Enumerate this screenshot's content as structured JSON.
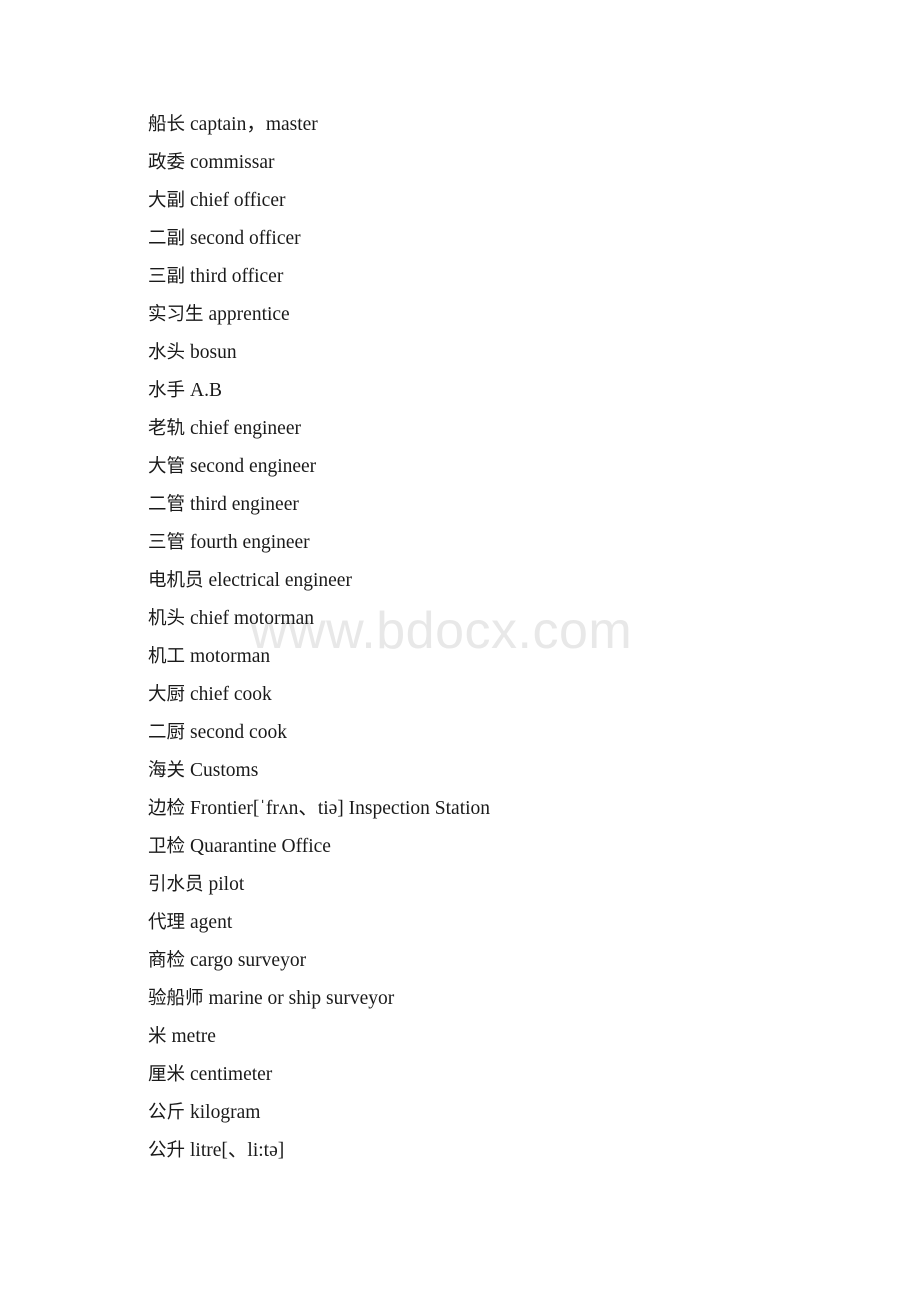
{
  "document": {
    "background_color": "#ffffff",
    "text_color": "#1a1a1a",
    "watermark": {
      "text": "www.bdocx.com",
      "color": "#e8e8e8"
    },
    "entries": [
      {
        "cn": "船长",
        "en": "captain，master"
      },
      {
        "cn": "政委",
        "en": "commissar"
      },
      {
        "cn": "大副",
        "en": "chief officer"
      },
      {
        "cn": "二副",
        "en": "second officer"
      },
      {
        "cn": "三副",
        "en": "third officer"
      },
      {
        "cn": "实习生",
        "en": "apprentice"
      },
      {
        "cn": "水头",
        "en": "bosun"
      },
      {
        "cn": "水手",
        "en": "A.B"
      },
      {
        "cn": "老轨",
        "en": "chief engineer"
      },
      {
        "cn": "大管",
        "en": "second engineer"
      },
      {
        "cn": "二管",
        "en": "third engineer"
      },
      {
        "cn": "三管",
        "en": "fourth engineer"
      },
      {
        "cn": "电机员",
        "en": "electrical engineer"
      },
      {
        "cn": "机头",
        "en": "chief motorman"
      },
      {
        "cn": "机工",
        "en": "motorman"
      },
      {
        "cn": "大厨",
        "en": "chief cook"
      },
      {
        "cn": "二厨",
        "en": "second cook"
      },
      {
        "cn": "海关",
        "en": "Customs"
      },
      {
        "cn": "边检",
        "en": "Frontier[ˈfrʌn、tiə] Inspection Station"
      },
      {
        "cn": "卫检",
        "en": "Quarantine Office"
      },
      {
        "cn": "引水员",
        "en": "pilot"
      },
      {
        "cn": "代理",
        "en": "agent"
      },
      {
        "cn": "商检",
        "en": "cargo surveyor"
      },
      {
        "cn": "验船师",
        "en": "marine or ship surveyor"
      },
      {
        "cn": "米",
        "en": "metre"
      },
      {
        "cn": "厘米",
        "en": "centimeter"
      },
      {
        "cn": "公斤",
        "en": "kilogram"
      },
      {
        "cn": "公升",
        "en": "litre[、li:tə]"
      }
    ]
  }
}
